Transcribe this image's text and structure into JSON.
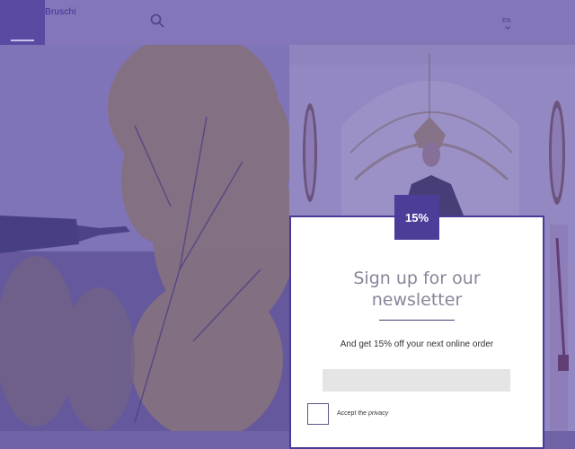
{
  "header": {
    "logo_text": "Bruschi",
    "language": "EN",
    "icons": {
      "menu": "menu-icon",
      "search": "search-icon",
      "language_chevron": "chevron-down-icon"
    }
  },
  "popup": {
    "badge": "15%",
    "title_line1": "Sign up for our",
    "title_line2": "newsletter",
    "subtitle": "And get 15% off your next online order",
    "email_placeholder": "",
    "accept_text": "Accept the",
    "privacy_link": "privacy"
  },
  "colors": {
    "overlay": "#5c4ea8",
    "badge": "#4b3d98",
    "header": "#8476b8",
    "input": "#e5e5e5"
  }
}
